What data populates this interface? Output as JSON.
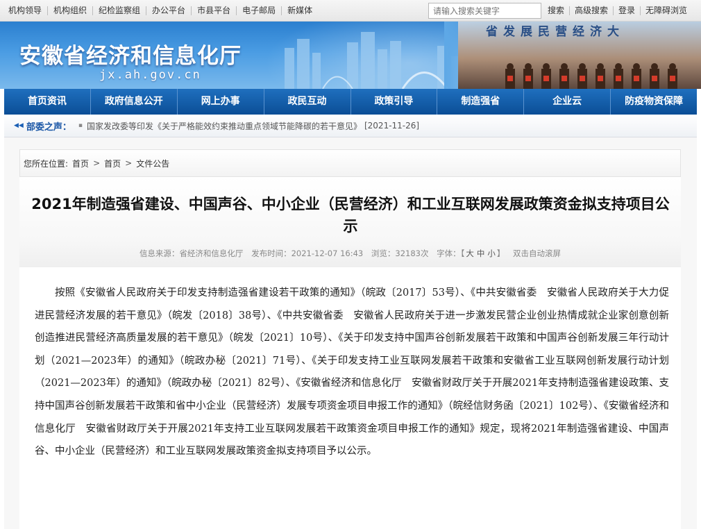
{
  "topbar": {
    "links": [
      "机构领导",
      "机构组织",
      "纪检监察组",
      "办公平台",
      "市县平台",
      "电子邮局",
      "新媒体"
    ],
    "search_placeholder": "请输入搜索关键字",
    "tools": [
      "搜索",
      "高级搜索",
      "登录",
      "无障碍浏览"
    ]
  },
  "header": {
    "title": "安徽省经济和信息化厅",
    "domain": "jx.ah.gov.cn",
    "banner_slogan": "省发展民营经济大"
  },
  "nav": {
    "items": [
      "首页资讯",
      "政府信息公开",
      "网上办事",
      "政民互动",
      "政策引导",
      "制造强省",
      "企业云",
      "防疫物资保障"
    ]
  },
  "ticker": {
    "label": "部委之声：",
    "news": "国家发改委等印发《关于严格能效约束推动重点领域节能降碳的若干意见》",
    "date": "[2021-11-26]"
  },
  "breadcrumb": {
    "prefix": "您所在位置:",
    "items": [
      "首页",
      "首页",
      "文件公告"
    ]
  },
  "article": {
    "title": "2021年制造强省建设、中国声谷、中小企业（民营经济）和工业互联网发展政策资金拟支持项目公示",
    "meta": {
      "source": "信息来源：省经济和信息化厅",
      "published": "发布时间：2021-12-07 16:43",
      "views": "浏览：32183次",
      "font_label": "字体：",
      "font_sizes": [
        "大",
        "中",
        "小"
      ],
      "autoscroll": "双击自动滚屏"
    },
    "body": "按照《安徽省人民政府关于印发支持制造强省建设若干政策的通知》（皖政〔2017〕53号）、《中共安徽省委　安徽省人民政府关于大力促进民营经济发展的若干意见》（皖发〔2018〕38号）、《中共安徽省委　安徽省人民政府关于进一步激发民营企业创业热情成就企业家创意创新创造推进民营经济高质量发展的若干意见》（皖发〔2021〕10号）、《关于印发支持中国声谷创新发展若干政策和中国声谷创新发展三年行动计划（2021—2023年）的通知》（皖政办秘〔2021〕71号）、《关于印发支持工业互联网发展若干政策和安徽省工业互联网创新发展行动计划（2021—2023年）的通知》（皖政办秘〔2021〕82号）、《安徽省经济和信息化厅　安徽省财政厅关于开展2021年支持制造强省建设政策、支持中国声谷创新发展若干政策和省中小企业（民营经济）发展专项资金项目申报工作的通知》（皖经信财务函〔2021〕102号）、《安徽省经济和信息化厅　安徽省财政厅关于开展2021年支持工业互联网发展若干政策资金项目申报工作的通知》规定，现将2021年制造强省建设、中国声谷、中小企业（民营经济）和工业互联网发展政策资金拟支持项目予以公示。"
  }
}
